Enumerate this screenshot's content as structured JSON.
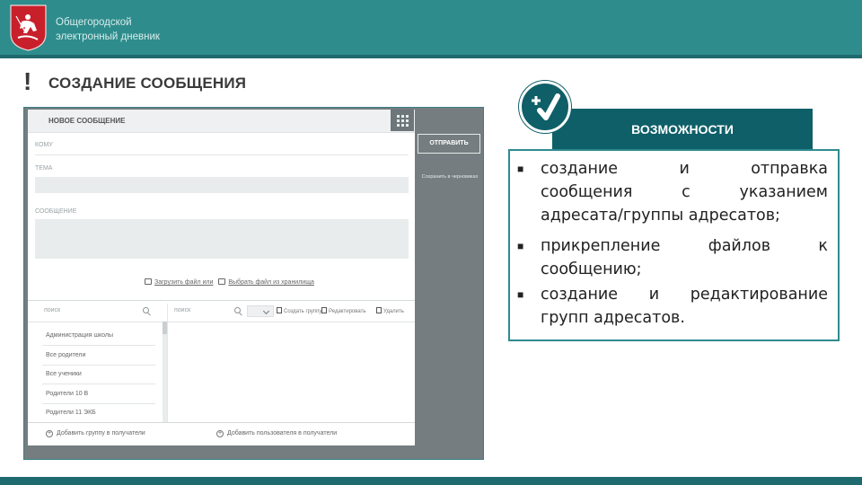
{
  "header": {
    "brand_line1": "Общегородской",
    "brand_line2": "электронный дневник",
    "logo_icon": "moscow-coat-of-arms-icon",
    "bar_color": "#2e8c8c"
  },
  "slide": {
    "exclamation": "!",
    "title": "СОЗДАНИЕ СООБЩЕНИЯ"
  },
  "form": {
    "heading": "НОВОЕ СООБЩЕНИЕ",
    "grid_icon": "grid-icon",
    "to_label": "КОМУ",
    "subject_label": "ТЕМА",
    "body_label": "СООБЩЕНИЕ",
    "attach_file": "Загрузить файл или",
    "attach_choose": "Выбрать файл из хранилища",
    "search_left": "поиск",
    "search_right": "поиск",
    "groups": [
      "Администрация школы",
      "Все родители",
      "Все ученики",
      "Родители 10 В",
      "Родители 11 ЭКБ"
    ],
    "toolbar": [
      "Создать группу",
      "Редактировать",
      "Удалить"
    ],
    "add_group": "Добавить группу в получатели",
    "add_user": "Добавить пользователя в получатели",
    "send_button": "ОТПРАВИТЬ",
    "side_link": "Сохранить в черновиках"
  },
  "possibilities": {
    "heading": "ВОЗМОЖНОСТИ",
    "icon": "plus-check-icon",
    "items": [
      {
        "lines": [
          "создание и отправка",
          "сообщения с указанием",
          "адресата/группы адресатов;"
        ]
      },
      {
        "lines": [
          "прикрепление файлов к",
          "сообщению;"
        ]
      },
      {
        "lines": [
          "создание и редактирование",
          "групп адресатов."
        ]
      }
    ]
  }
}
